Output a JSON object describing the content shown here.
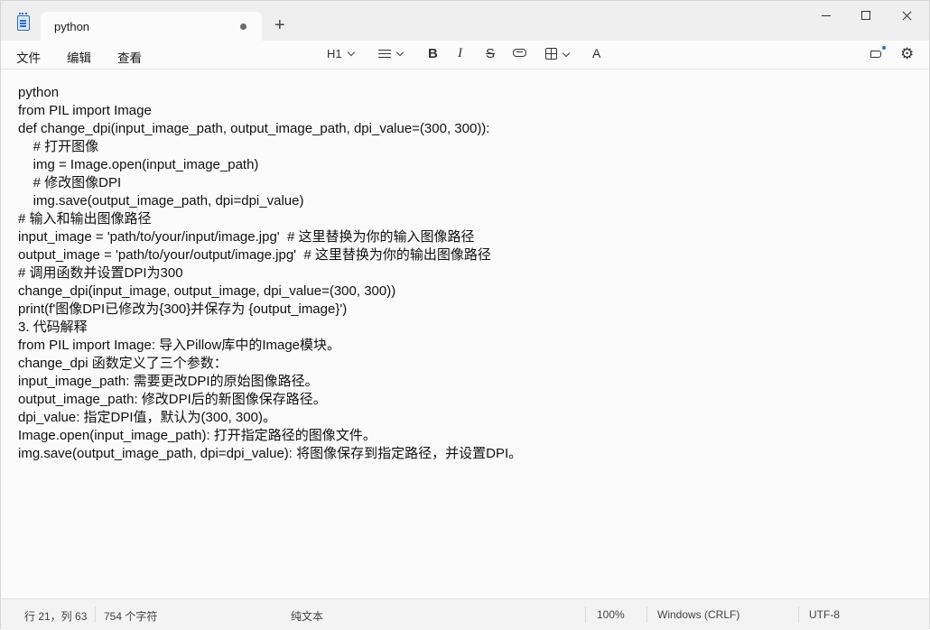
{
  "tab": {
    "title": "python"
  },
  "menu": {
    "file": "文件",
    "edit": "编辑",
    "view": "查看"
  },
  "toolbar": {
    "heading": "H1",
    "bold": "B",
    "italic": "I",
    "strike": "S",
    "spell": "A"
  },
  "editor": {
    "lines": [
      "python",
      "from PIL import Image",
      "def change_dpi(input_image_path, output_image_path, dpi_value=(300, 300)):",
      "    # 打开图像",
      "    img = Image.open(input_image_path)",
      "    # 修改图像DPI",
      "    img.save(output_image_path, dpi=dpi_value)",
      "# 输入和输出图像路径",
      "input_image = 'path/to/your/input/image.jpg'  # 这里替换为你的输入图像路径",
      "output_image = 'path/to/your/output/image.jpg'  # 这里替换为你的输出图像路径",
      "# 调用函数并设置DPI为300",
      "change_dpi(input_image, output_image, dpi_value=(300, 300))",
      "print(f'图像DPI已修改为{300}并保存为 {output_image}')",
      "3. 代码解释",
      "from PIL import Image: 导入Pillow库中的Image模块。",
      "change_dpi 函数定义了三个参数：",
      "input_image_path: 需要更改DPI的原始图像路径。",
      "output_image_path: 修改DPI后的新图像保存路径。",
      "dpi_value: 指定DPI值，默认为(300, 300)。",
      "Image.open(input_image_path): 打开指定路径的图像文件。",
      "img.save(output_image_path, dpi=dpi_value): 将图像保存到指定路径，并设置DPI。"
    ]
  },
  "status": {
    "position": "行 21，列 63",
    "chars": "754 个字符",
    "format": "纯文本",
    "zoom": "100%",
    "line_ending": "Windows (CRLF)",
    "encoding": "UTF-8"
  }
}
